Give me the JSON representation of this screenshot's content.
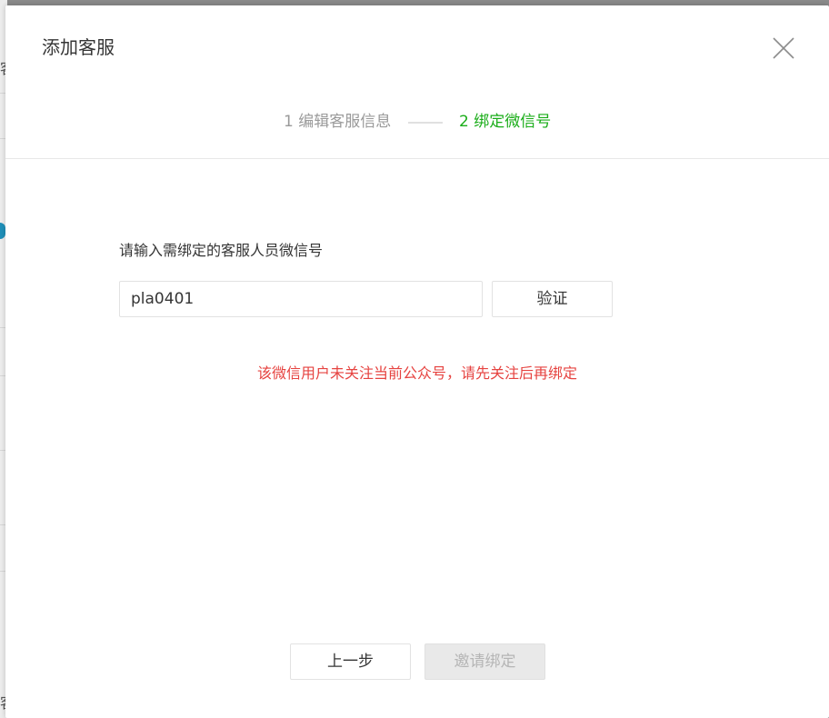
{
  "background": {
    "chars": [
      "客",
      "客"
    ]
  },
  "dialog": {
    "title": "添加客服",
    "close_icon": "close-icon"
  },
  "steps": [
    {
      "label": "1 编辑客服信息",
      "state": "done",
      "color": "#9a9a9a"
    },
    {
      "label": "2 绑定微信号",
      "state": "active",
      "color": "#1aad19"
    }
  ],
  "form": {
    "label": "请输入需绑定的客服人员微信号",
    "input_value": "pla0401",
    "verify_label": "验证",
    "error_message": "该微信用户未关注当前公众号，请先关注后再绑定",
    "error_color": "#e64340"
  },
  "footer": {
    "prev_label": "上一步",
    "invite_label": "邀请绑定",
    "invite_disabled": true
  }
}
